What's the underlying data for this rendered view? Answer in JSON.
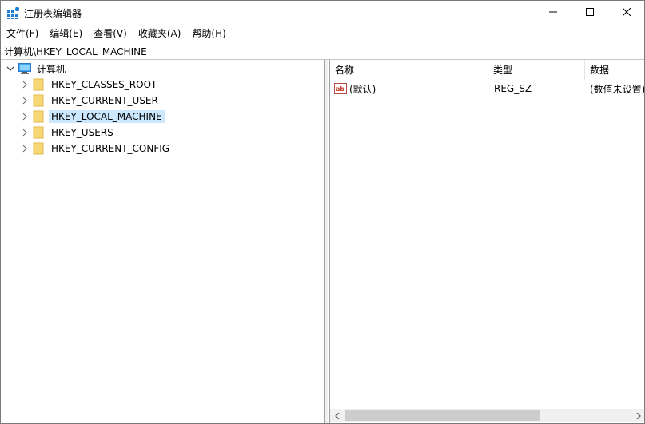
{
  "window": {
    "title": "注册表编辑器",
    "app_icon": "registry-editor-icon",
    "controls": {
      "minimize": "minimize-icon",
      "maximize": "maximize-icon",
      "close": "close-icon"
    }
  },
  "menu": {
    "items": [
      {
        "label": "文件(F)"
      },
      {
        "label": "编辑(E)"
      },
      {
        "label": "查看(V)"
      },
      {
        "label": "收藏夹(A)"
      },
      {
        "label": "帮助(H)"
      }
    ]
  },
  "address": {
    "path": "计算机\\HKEY_LOCAL_MACHINE"
  },
  "tree": {
    "root": {
      "label": "计算机",
      "icon": "computer-icon",
      "expanded": true
    },
    "items": [
      {
        "label": "HKEY_CLASSES_ROOT",
        "icon": "folder-icon",
        "selected": false
      },
      {
        "label": "HKEY_CURRENT_USER",
        "icon": "folder-icon",
        "selected": false
      },
      {
        "label": "HKEY_LOCAL_MACHINE",
        "icon": "folder-icon",
        "selected": true
      },
      {
        "label": "HKEY_USERS",
        "icon": "folder-icon",
        "selected": false
      },
      {
        "label": "HKEY_CURRENT_CONFIG",
        "icon": "folder-icon",
        "selected": false
      }
    ]
  },
  "list": {
    "columns": [
      "名称",
      "类型",
      "数据"
    ],
    "rows": [
      {
        "icon": "string-value-icon",
        "name": "(默认)",
        "type": "REG_SZ",
        "data": "(数值未设置)"
      }
    ]
  },
  "colors": {
    "selection": "#cce8ff",
    "folder": "#f8d775",
    "scroll_thumb": "#cdcdcd",
    "app_icon": "#1e7fd8"
  }
}
